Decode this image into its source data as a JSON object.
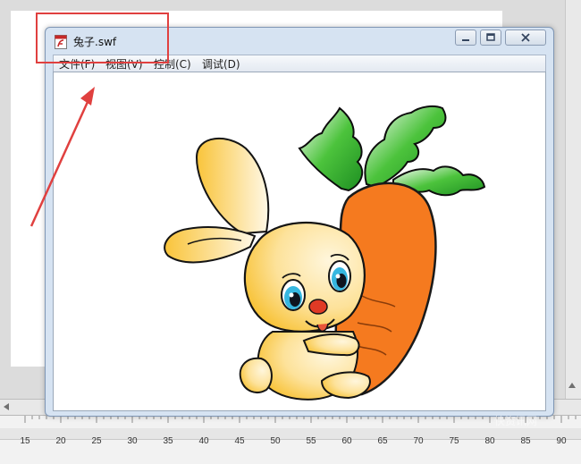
{
  "window": {
    "title": "兔子.swf",
    "icon": "swf-file-icon",
    "controls": [
      "minimize-icon",
      "maximize-icon",
      "close-icon"
    ]
  },
  "menu": {
    "items": [
      {
        "label": "文件(F)"
      },
      {
        "label": "视图(V)"
      },
      {
        "label": "控制(C)"
      },
      {
        "label": "调试(D)"
      }
    ]
  },
  "stage": {
    "content": "rabbit-holding-carrot-illustration"
  },
  "timeline": {
    "ruler_labels": [
      "15",
      "20",
      "25",
      "30",
      "35",
      "40",
      "45",
      "50",
      "55",
      "60",
      "65",
      "70",
      "75",
      "80",
      "85",
      "90"
    ]
  },
  "watermark": {
    "text": "快资讯网"
  },
  "colors": {
    "annotation": "#e0403f",
    "carrot": "#f57a1f",
    "leaves": "#3fb536",
    "rabbit": "#fcd56a"
  }
}
